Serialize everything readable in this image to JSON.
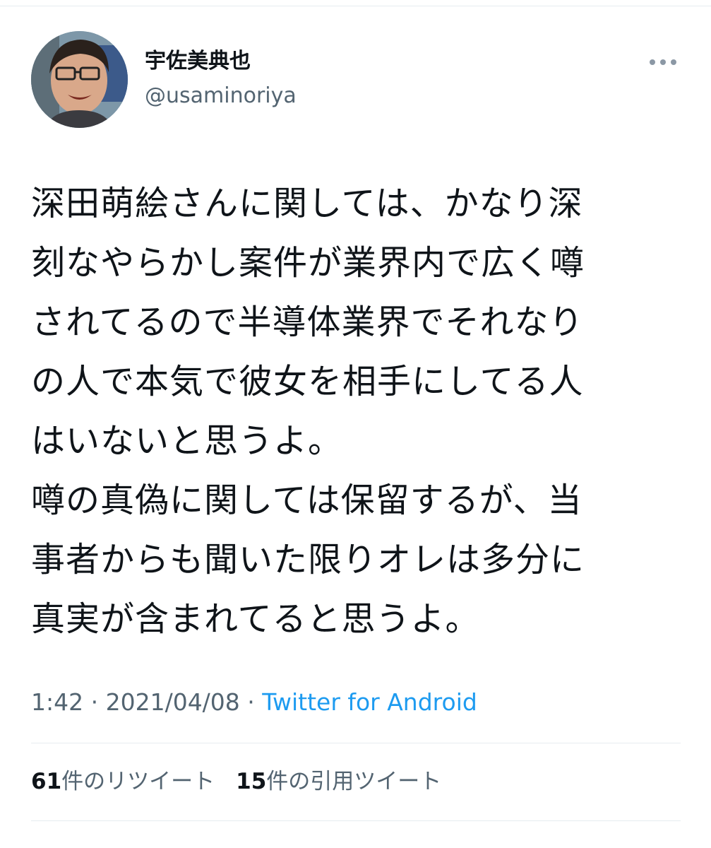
{
  "user": {
    "display_name": "宇佐美典也",
    "handle": "@usaminoriya",
    "avatar_icon": "user-avatar-photo"
  },
  "header": {
    "more_icon": "more-dots-icon"
  },
  "tweet": {
    "lines": [
      "深田萌絵さんに関しては、かなり深",
      "刻なやらかし案件が業界内で広く噂",
      "されてるので半導体業界でそれなり",
      "の人で本気で彼女を相手にしてる人",
      "はいないと思うよ。",
      "噂の真偽に関しては保留するが、当",
      "事者からも聞いた限りオレは多分に",
      "真実が含まれてると思うよ。"
    ]
  },
  "meta": {
    "time": "1:42",
    "separator": " · ",
    "date": "2021/04/08",
    "source": "Twitter for Android"
  },
  "stats": {
    "retweets_count": "61",
    "retweets_label": "件のリツイート",
    "quotes_count": "15",
    "quotes_label": "件の引用ツイート"
  },
  "colors": {
    "text": "#0f1419",
    "secondary": "#536471",
    "link": "#1d9bf0",
    "divider": "#e6ecf0"
  }
}
